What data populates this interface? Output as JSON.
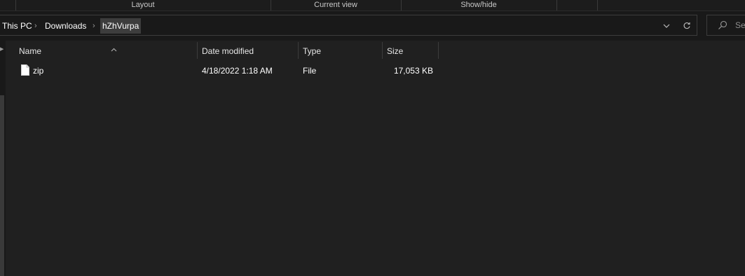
{
  "ribbon": {
    "groups": [
      "Layout",
      "Current view",
      "Show/hide"
    ]
  },
  "address": {
    "crumbs": [
      "This PC",
      "Downloads",
      "hZhVurpa"
    ],
    "separator": "›",
    "dropdown_icon": "chevron-down-icon",
    "refresh_icon": "refresh-icon"
  },
  "search": {
    "placeholder": "Search hZhVurpa",
    "visible_text": "Sea",
    "icon": "search-icon"
  },
  "file_list": {
    "columns": [
      "Name",
      "Date modified",
      "Type",
      "Size"
    ],
    "sorted_by": "Name",
    "sort_indicator": "^",
    "rows": [
      {
        "name": "zip",
        "date_modified": "4/18/2022 1:18 AM",
        "type": "File",
        "size": "17,053 KB",
        "icon": "file-icon"
      }
    ]
  },
  "theme": {
    "background": "#191919",
    "content_background": "#202020",
    "selected_crumb": "#3d3d3d",
    "text": "#ffffff"
  }
}
